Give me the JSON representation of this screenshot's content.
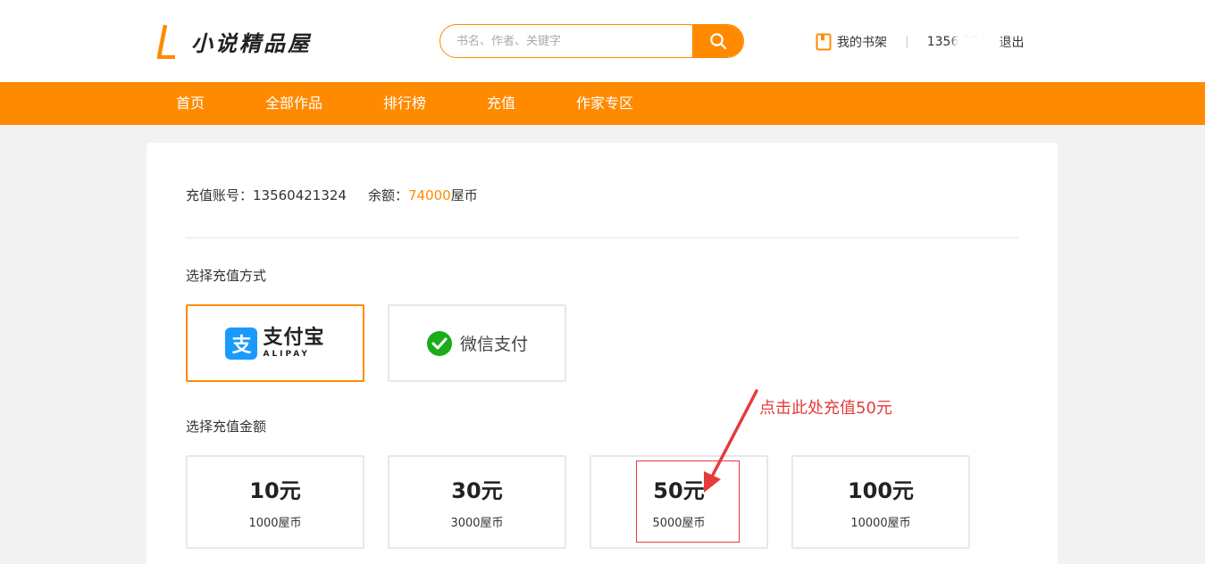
{
  "header": {
    "logo_text": "小说精品屋",
    "search": {
      "placeholder": "书名、作者、关键字",
      "value": ""
    },
    "shelf_label": "我的书架",
    "separator": "|",
    "phone_masked": "1356 324",
    "logout_label": "退出"
  },
  "nav": {
    "items": [
      {
        "label": "首页"
      },
      {
        "label": "全部作品"
      },
      {
        "label": "排行榜"
      },
      {
        "label": "充值"
      },
      {
        "label": "作家专区"
      }
    ]
  },
  "account": {
    "account_label": "充值账号：13560421324",
    "balance_label": "余额：",
    "balance_value": "74000",
    "balance_unit": "屋币"
  },
  "payment": {
    "title": "选择充值方式",
    "alipay": {
      "icon_char": "支",
      "cn": "支付宝",
      "en": "ALIPAY"
    },
    "wechat": {
      "label": "微信支付"
    }
  },
  "amounts": {
    "title": "选择充值金额",
    "options": [
      {
        "yuan": "10元",
        "coins": "1000屋币"
      },
      {
        "yuan": "30元",
        "coins": "3000屋币"
      },
      {
        "yuan": "50元",
        "coins": "5000屋币"
      },
      {
        "yuan": "100元",
        "coins": "10000屋币"
      }
    ]
  },
  "annotation": {
    "text": "点击此处充值50元"
  },
  "colors": {
    "accent": "#ff8a00",
    "annotation": "#e53b3b",
    "alipay": "#1a9bfc",
    "wechat": "#1aad19"
  }
}
